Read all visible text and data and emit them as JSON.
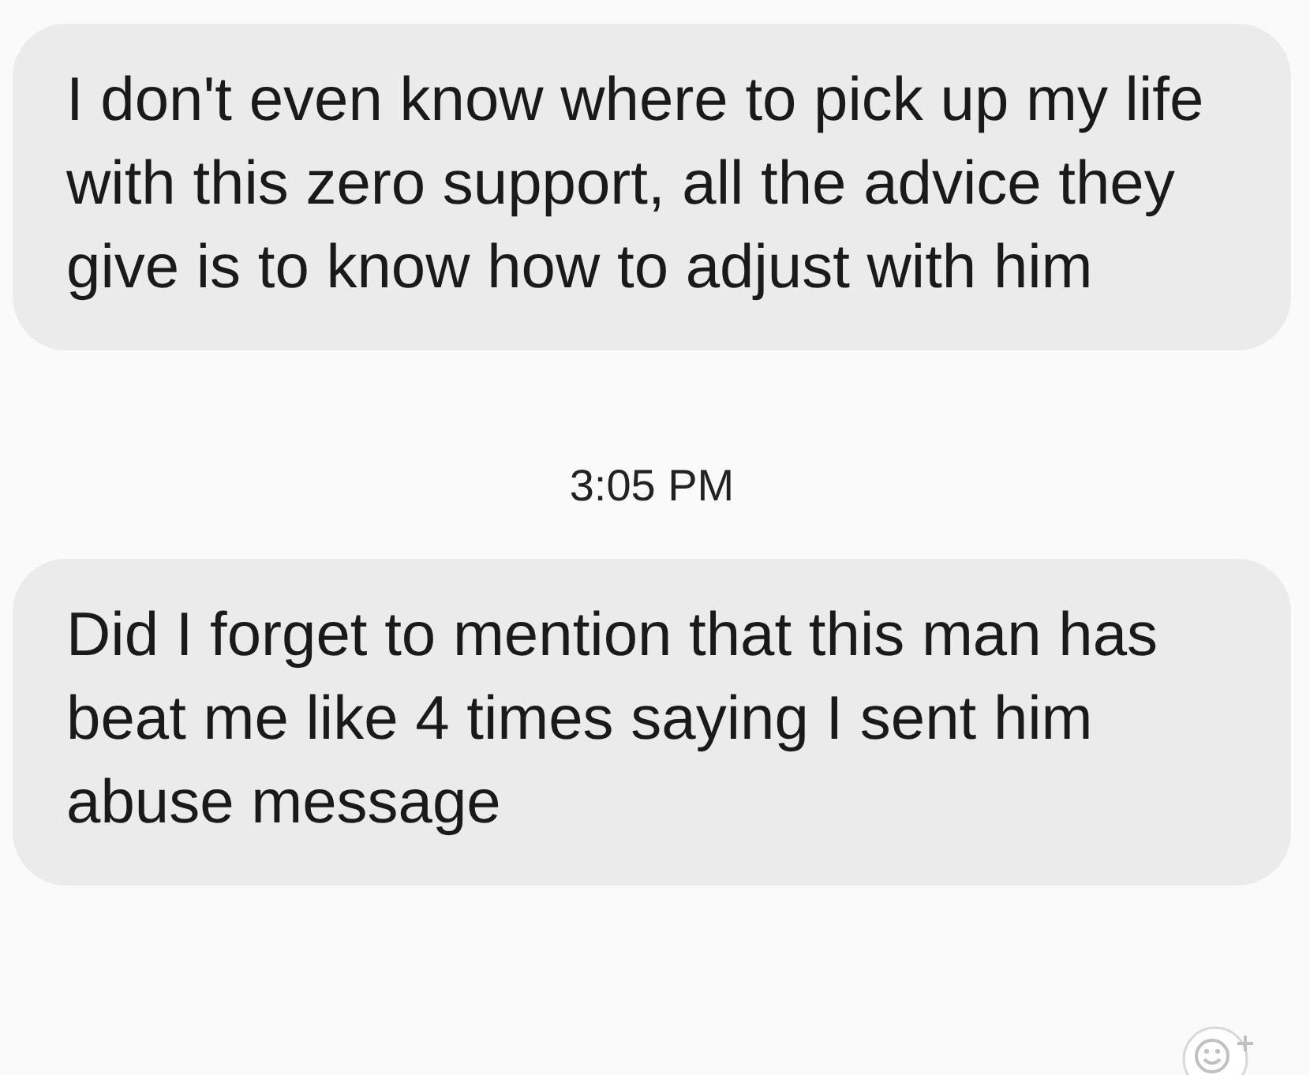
{
  "messages": [
    {
      "text": "I don't even know where to pick up my life with this zero support, all the advice they give is to know how to adjust with him"
    },
    {
      "kind": "timestamp",
      "text": "3:05 PM"
    },
    {
      "text": "Did I forget to mention that this man has beat me like 4 times saying I sent him abuse message"
    }
  ]
}
